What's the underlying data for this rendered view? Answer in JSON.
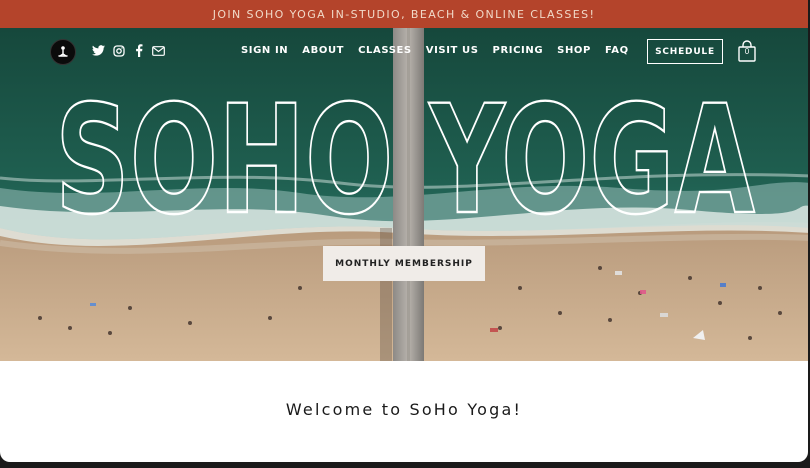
{
  "announcement": {
    "text": "JOIN SOHO YOGA IN-STUDIO, BEACH & ONLINE CLASSES!"
  },
  "nav": {
    "menu": [
      {
        "label": "SIGN IN"
      },
      {
        "label": "ABOUT"
      },
      {
        "label": "CLASSES"
      },
      {
        "label": "VISIT US"
      },
      {
        "label": "PRICING"
      },
      {
        "label": "SHOP"
      },
      {
        "label": "FAQ"
      }
    ],
    "schedule_label": "SCHEDULE",
    "cart_count": "0",
    "socials": [
      "twitter-icon",
      "instagram-icon",
      "facebook-icon",
      "email-icon"
    ]
  },
  "hero": {
    "title": "SOHO YOGA",
    "cta_label": "MONTHLY MEMBERSHIP"
  },
  "welcome": {
    "text": "Welcome to SoHo Yoga!"
  },
  "colors": {
    "announcement_bg": "#b4442b",
    "ocean": "#1f5a4c",
    "sand": "#c9a88a",
    "cta_bg": "#f0ece8"
  }
}
